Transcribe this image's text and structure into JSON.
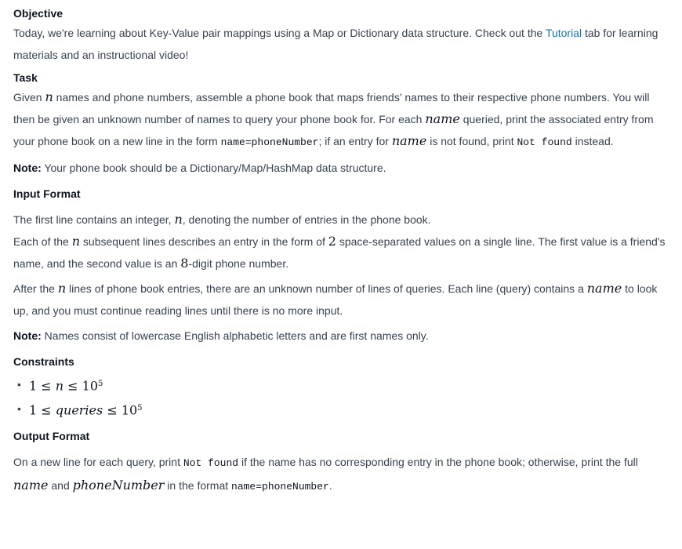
{
  "objective": {
    "heading": "Objective",
    "text1": "Today, we're learning about Key-Value pair mappings using a Map or Dictionary data structure. Check out the ",
    "link": "Tutorial",
    "text2": " tab for learning materials and an instructional video!"
  },
  "task": {
    "heading": "Task",
    "p1_a": "Given ",
    "var_n": "n",
    "p1_b": " names and phone numbers, assemble a phone book that maps friends' names to their respective phone numbers. You will then be given an unknown number of names to query your phone book for. For each ",
    "var_name": "name",
    "p1_c": " queried, print the associated entry from your phone book on a new line in the form ",
    "code_form": "name=phoneNumber",
    "p1_d": "; if an entry for ",
    "p1_e": " is not found, print ",
    "code_notfound": "Not found",
    "p1_f": " instead.",
    "note_label": "Note:",
    "note_text": " Your phone book should be a Dictionary/Map/HashMap data structure."
  },
  "input_format": {
    "heading": "Input Format",
    "l1_a": "The first line contains an integer, ",
    "l1_b": ", denoting the number of entries in the phone book.",
    "l2_a": "Each of the ",
    "l2_b": " subsequent lines describes an entry in the form of ",
    "two": "2",
    "l2_c": " space-separated values on a single line. The first value is a friend's name, and the second value is an ",
    "eight": "8",
    "l2_d": "-digit phone number.",
    "p2_a": "After the ",
    "p2_b": " lines of phone book entries, there are an unknown number of lines of queries. Each line (query) contains a ",
    "p2_c": " to look up, and you must continue reading lines until there is no more input.",
    "note_label": "Note:",
    "note_text": " Names consist of lowercase English alphabetic letters and are first names only."
  },
  "constraints": {
    "heading": "Constraints",
    "c1_a": "1 ≤ ",
    "c1_var": "n",
    "c1_b": " ≤ 10",
    "c1_exp": "5",
    "c2_a": "1 ≤ ",
    "c2_var": "queries",
    "c2_b": " ≤ 10",
    "c2_exp": "5"
  },
  "output_format": {
    "heading": "Output Format",
    "t1": "On a new line for each query, print ",
    "code_notfound": "Not found",
    "t2": " if the name has no corresponding entry in the phone book; otherwise, print the full ",
    "var_name": "name",
    "t3": " and ",
    "var_phone": "phoneNumber",
    "t4": " in the format ",
    "code_form": "name=phoneNumber",
    "t5": "."
  }
}
